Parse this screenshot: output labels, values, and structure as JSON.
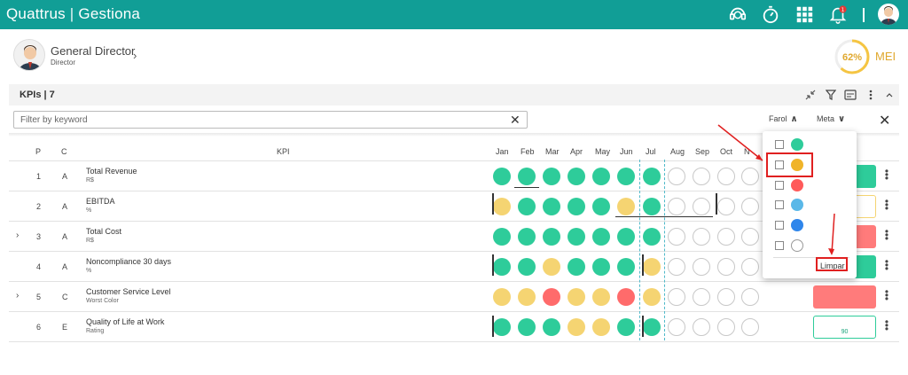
{
  "header": {
    "brand_left": "Quattrus",
    "brand_sep": "|",
    "brand_right": "Gestiona",
    "notification_count": "1",
    "icons": [
      "support-icon",
      "stopwatch-icon",
      "apps-grid-icon",
      "bell-icon",
      "user-avatar-icon"
    ]
  },
  "profile": {
    "name": "General Director",
    "role": "Director"
  },
  "mei": {
    "value": 62,
    "label": "MEI",
    "percent_text": "62%"
  },
  "kpis": {
    "title": "KPIs | 7"
  },
  "filter": {
    "placeholder": "Filter by keyword",
    "value": ""
  },
  "columns": {
    "farol": "Farol",
    "meta": "Meta",
    "p": "P",
    "c": "C",
    "kpi": "KPI",
    "months": [
      "Jan",
      "Feb",
      "Mar",
      "Apr",
      "May",
      "Jun",
      "Jul",
      "Aug",
      "Sep",
      "Oct",
      "N"
    ]
  },
  "rows": [
    {
      "p": "1",
      "c": "A",
      "name": "Total Revenue",
      "unit": "R$",
      "expandable": false,
      "colors": [
        "green",
        "green",
        "green",
        "green",
        "green",
        "green",
        "green",
        "empty",
        "empty",
        "empty",
        "empty"
      ],
      "meta_style": "green",
      "meta_text": ""
    },
    {
      "p": "2",
      "c": "A",
      "name": "EBITDA",
      "unit": "%",
      "expandable": false,
      "colors": [
        "yellow",
        "green",
        "green",
        "green",
        "green",
        "yellow",
        "green",
        "empty",
        "empty",
        "empty",
        "empty"
      ],
      "meta_style": "yellow-outline",
      "meta_text": ""
    },
    {
      "p": "3",
      "c": "A",
      "name": "Total Cost",
      "unit": "R$",
      "expandable": true,
      "colors": [
        "green",
        "green",
        "green",
        "green",
        "green",
        "green",
        "green",
        "empty",
        "empty",
        "empty",
        "empty"
      ],
      "meta_style": "red",
      "meta_text": ""
    },
    {
      "p": "4",
      "c": "A",
      "name": "Noncompliance 30 days",
      "unit": "%",
      "expandable": false,
      "colors": [
        "green",
        "green",
        "yellow",
        "green",
        "green",
        "green",
        "yellow",
        "empty",
        "empty",
        "empty",
        "empty"
      ],
      "meta_style": "green",
      "meta_text": ""
    },
    {
      "p": "5",
      "c": "C",
      "name": "Customer Service Level",
      "unit": "Worst Color",
      "expandable": true,
      "colors": [
        "yellow",
        "yellow",
        "red",
        "yellow",
        "yellow",
        "red",
        "yellow",
        "empty",
        "empty",
        "empty",
        "empty"
      ],
      "meta_style": "red",
      "meta_text": ""
    },
    {
      "p": "6",
      "c": "E",
      "name": "Quality of Life at Work",
      "unit": "Rating",
      "expandable": false,
      "colors": [
        "green",
        "green",
        "green",
        "yellow",
        "yellow",
        "green",
        "green",
        "empty",
        "empty",
        "empty",
        "empty"
      ],
      "meta_style": "outline",
      "meta_text": "90"
    }
  ],
  "farol_filter": {
    "options": [
      {
        "name": "green",
        "color": "#2ecc9a"
      },
      {
        "name": "yellow",
        "color": "#f0b429"
      },
      {
        "name": "red",
        "color": "#ff5a5a"
      },
      {
        "name": "light-blue",
        "color": "#5ab8e8"
      },
      {
        "name": "blue",
        "color": "#2f86eb"
      },
      {
        "name": "none",
        "color": "#ffffff"
      }
    ],
    "clear_label": "Limpar"
  },
  "colors": {
    "teal": "#119e96",
    "gauge": "#f5c542"
  }
}
